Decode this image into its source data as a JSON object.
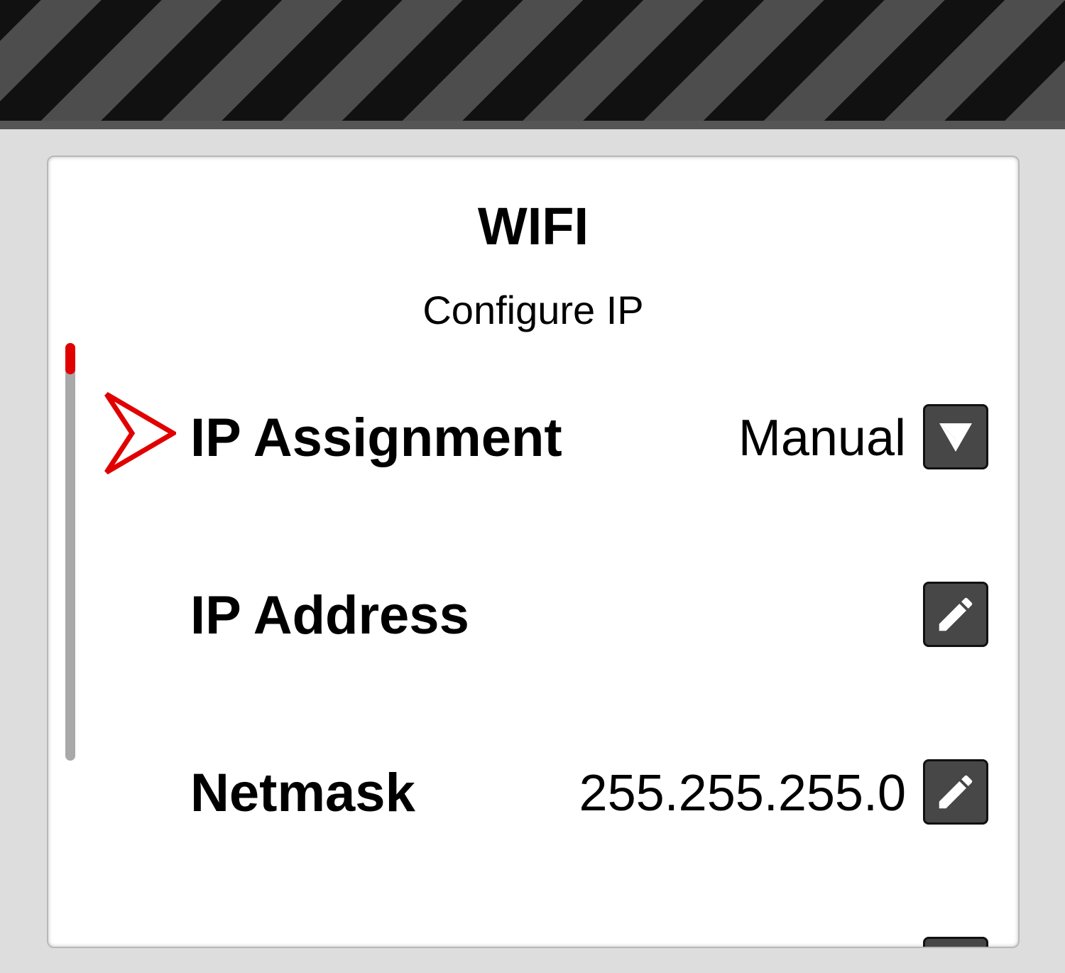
{
  "screen": {
    "title": "WIFI",
    "subtitle": "Configure IP"
  },
  "rows": [
    {
      "label": "IP Assignment",
      "value": "Manual",
      "action_icon": "dropdown-arrow-icon",
      "selected": true
    },
    {
      "label": "IP Address",
      "value": "",
      "action_icon": "pencil-icon",
      "selected": false
    },
    {
      "label": "Netmask",
      "value": "255.255.255.0",
      "action_icon": "pencil-icon",
      "selected": false
    }
  ],
  "scrollbar": {
    "position_fraction": 0.0
  },
  "colors": {
    "accent": "#e00000",
    "button": "#474747",
    "panel": "#ffffff",
    "background": "#dddddd"
  }
}
